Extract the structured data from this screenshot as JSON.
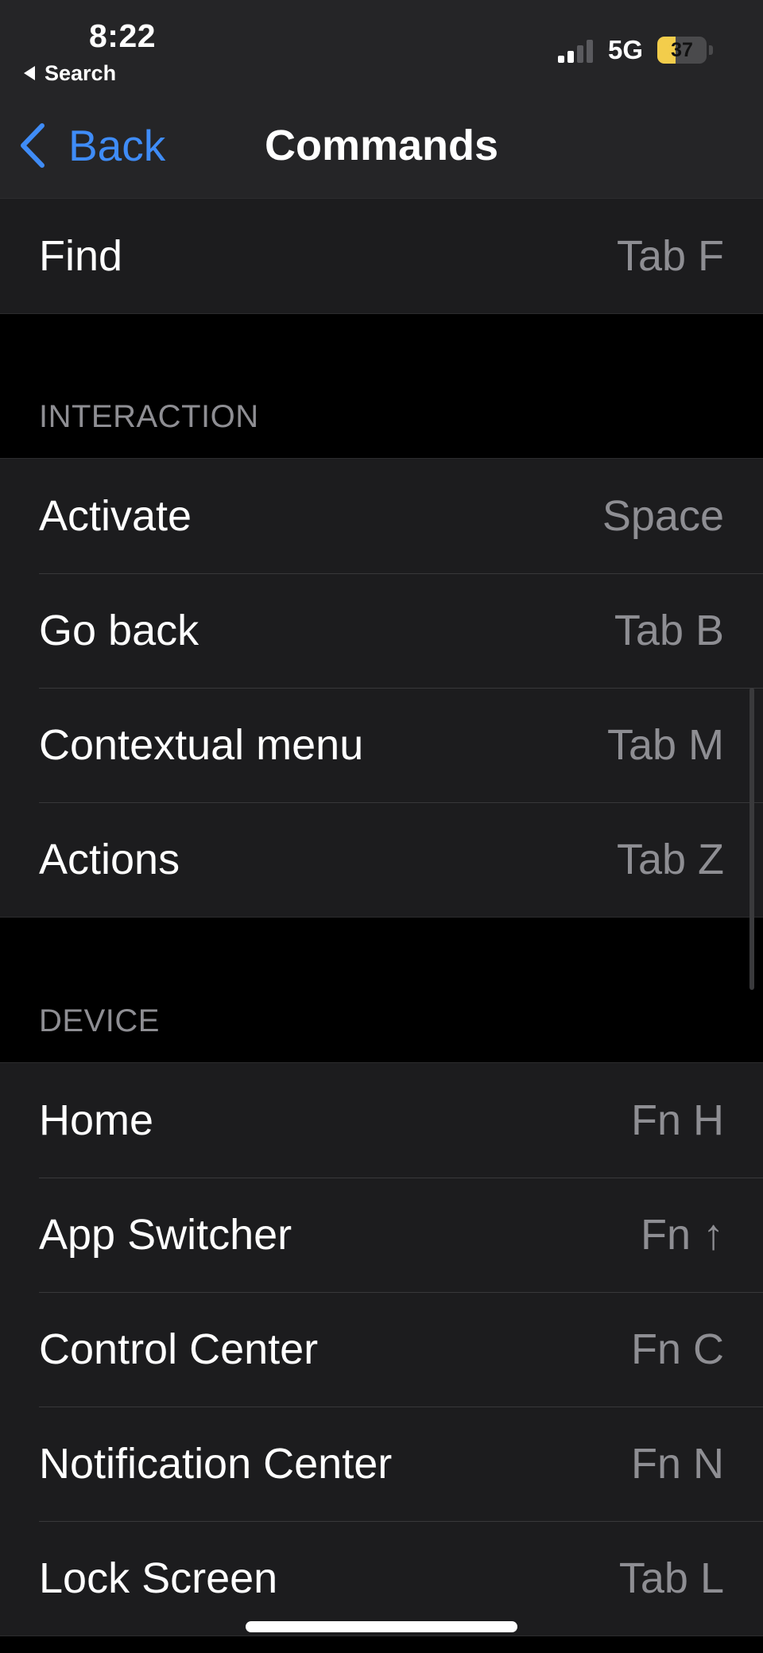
{
  "status_bar": {
    "time": "8:22",
    "back_app_label": "Search",
    "network": "5G",
    "battery_level": "37",
    "battery_fraction": 0.37,
    "battery_color": "#f3cd4b"
  },
  "nav": {
    "back_label": "Back",
    "title": "Commands",
    "accent_color": "#3f8cf7"
  },
  "top_group": [
    {
      "title": "Find",
      "shortcut": "Tab F"
    }
  ],
  "interaction": {
    "header": "INTERACTION",
    "rows": [
      {
        "title": "Activate",
        "shortcut": "Space"
      },
      {
        "title": "Go back",
        "shortcut": "Tab B"
      },
      {
        "title": "Contextual menu",
        "shortcut": "Tab M"
      },
      {
        "title": "Actions",
        "shortcut": "Tab Z"
      }
    ]
  },
  "device": {
    "header": "DEVICE",
    "rows": [
      {
        "title": "Home",
        "shortcut": "Fn H"
      },
      {
        "title": "App Switcher",
        "shortcut": "Fn ↑"
      },
      {
        "title": "Control Center",
        "shortcut": "Fn C"
      },
      {
        "title": "Notification Center",
        "shortcut": "Fn N"
      },
      {
        "title": "Lock Screen",
        "shortcut": "Tab L"
      }
    ]
  }
}
